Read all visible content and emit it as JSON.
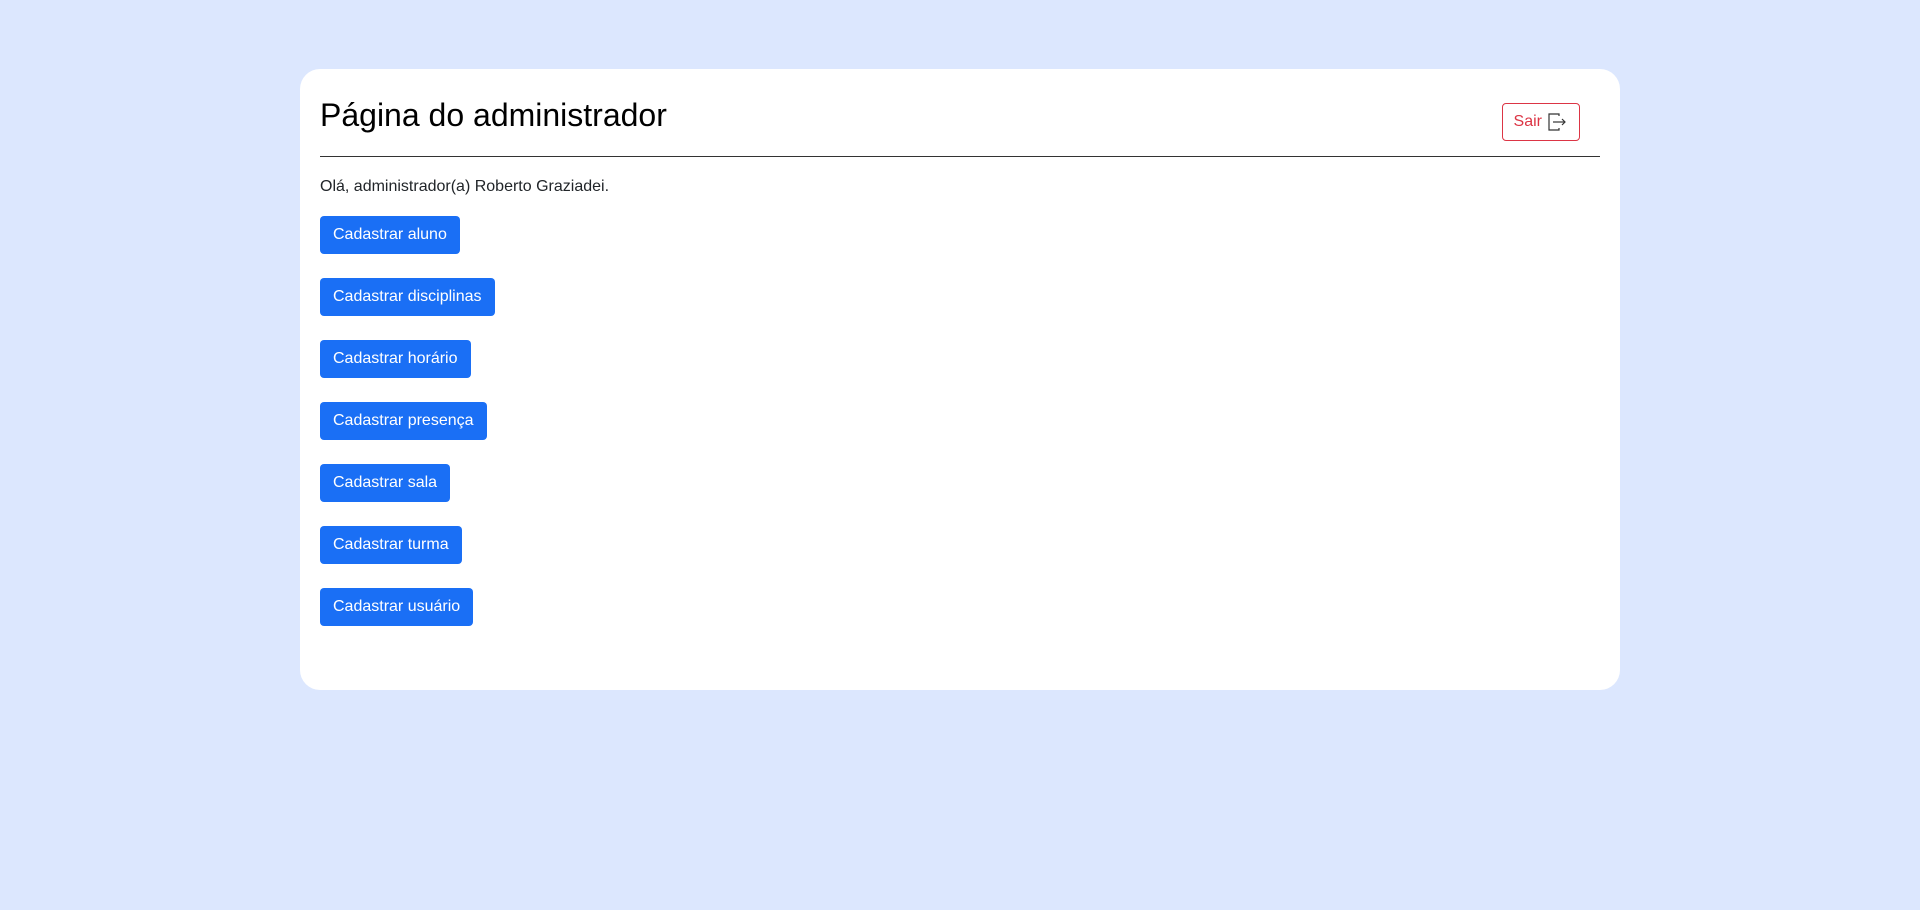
{
  "page": {
    "title": "Página do administrador",
    "greeting": "Olá, administrador(a) Roberto Graziadei."
  },
  "logout": {
    "label": "Sair",
    "icon": "box-arrow-right-icon"
  },
  "actions": [
    {
      "label": "Cadastrar aluno"
    },
    {
      "label": "Cadastrar disciplinas"
    },
    {
      "label": "Cadastrar horário"
    },
    {
      "label": "Cadastrar presença"
    },
    {
      "label": "Cadastrar sala"
    },
    {
      "label": "Cadastrar turma"
    },
    {
      "label": "Cadastrar usuário"
    }
  ],
  "colors": {
    "background": "#dce7fe",
    "primary": "#1a6ff5",
    "danger": "#dc3545"
  }
}
